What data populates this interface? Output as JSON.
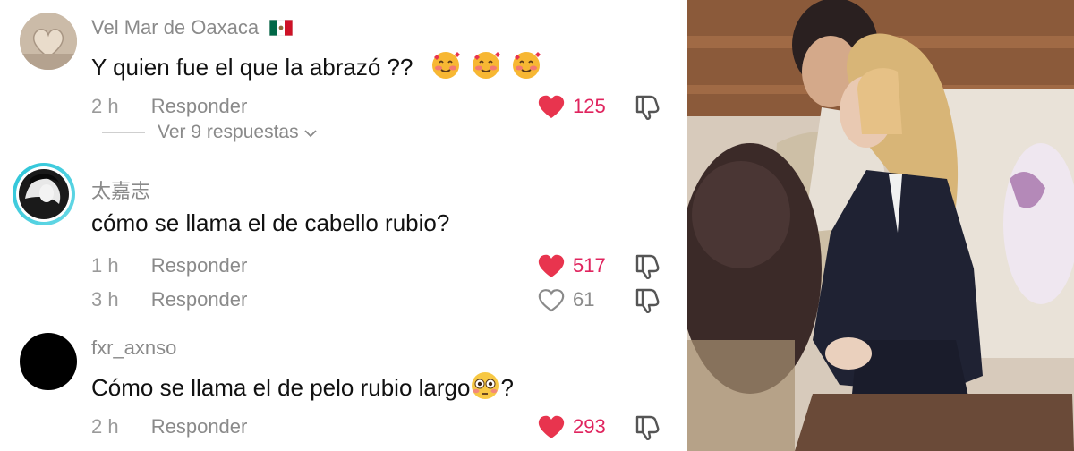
{
  "comments": [
    {
      "username": "Vel Mar de Oaxaca",
      "flag_icon": "mexico-flag-icon",
      "text": "Y quien fue el que la abrazó ??",
      "emoji_icon": "smiling-face-with-hearts-icon",
      "time": "2 h",
      "reply_label": "Responder",
      "likes": "125",
      "liked": true,
      "view_replies": "Ver 9 respuestas"
    },
    {
      "username": "太嘉志",
      "text": "cómo se llama el de cabello rubio?",
      "time": "1 h",
      "reply_label": "Responder",
      "likes": "517",
      "liked": true
    },
    {
      "time": "3 h",
      "reply_label": "Responder",
      "likes": "61",
      "liked": false
    },
    {
      "username": "fxr_axnso",
      "text": "Cómo se llama el de pelo rubio largo",
      "text_suffix": "?",
      "emoji_icon": "flushed-face-icon",
      "time": "2 h",
      "reply_label": "Responder",
      "likes": "293",
      "liked": true
    }
  ],
  "colors": {
    "like_red": "#e0245e",
    "muted_text": "#8a8a8a",
    "main_text": "#111111"
  }
}
